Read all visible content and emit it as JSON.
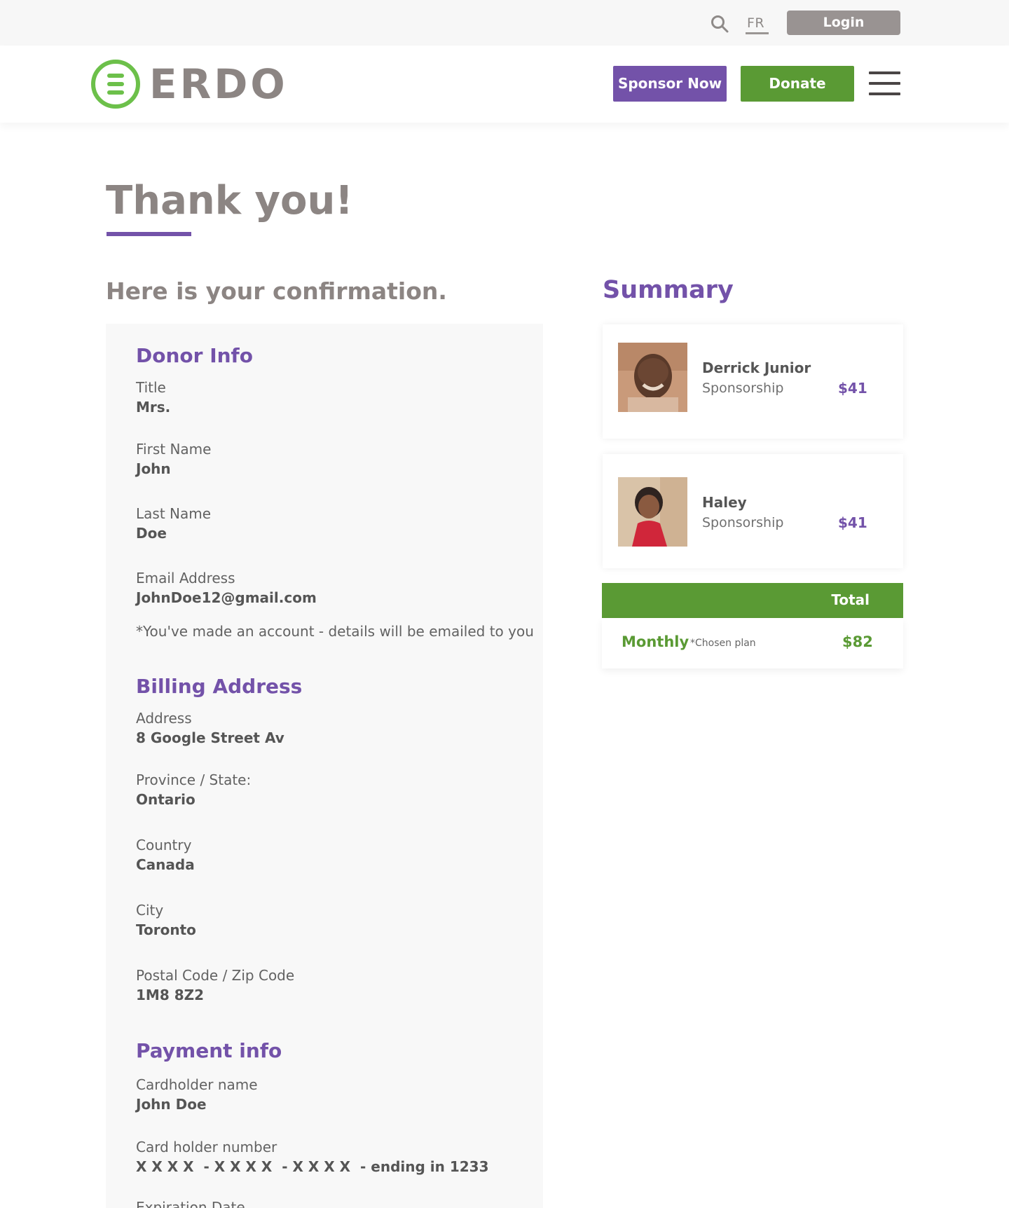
{
  "topbar": {
    "language": "FR",
    "login_label": "Login"
  },
  "header": {
    "logo_text": "ERDO",
    "sponsor_label": "Sponsor Now",
    "donate_label": "Donate"
  },
  "page": {
    "title": "Thank you!",
    "confirmation_heading": "Here is your confirmation."
  },
  "donor_info": {
    "heading": "Donor Info",
    "title_label": "Title",
    "title_value": "Mrs.",
    "first_name_label": "First Name",
    "first_name_value": "John",
    "last_name_label": "Last Name",
    "last_name_value": "Doe",
    "email_label": "Email Address",
    "email_value": "JohnDoe12@gmail.com",
    "account_note": "*You've made an account - details will be emailed to you"
  },
  "billing": {
    "heading": "Billing Address",
    "address_label": "Address",
    "address_value": "8 Google Street Av",
    "province_label": "Province / State:",
    "province_value": "Ontario",
    "country_label": "Country",
    "country_value": "Canada",
    "city_label": "City",
    "city_value": "Toronto",
    "postal_label": "Postal Code / Zip Code",
    "postal_value": "1M8 8Z2"
  },
  "payment": {
    "heading": "Payment info",
    "cardholder_label": "Cardholder name",
    "cardholder_value": "John Doe",
    "card_number_label": "Card holder number",
    "card_number_value": "X X X X  - X X X X  - X X X X  - ending in 1233",
    "expiration_label": "Expiration Date"
  },
  "summary": {
    "heading": "Summary",
    "items": [
      {
        "name": "Derrick Junior",
        "type": "Sponsorship",
        "price": "$41"
      },
      {
        "name": "Haley",
        "type": "Sponsorship",
        "price": "$41"
      }
    ],
    "total_label": "Total",
    "plan": "Monthly",
    "plan_note": "*Chosen plan",
    "total_amount": "$82"
  },
  "colors": {
    "brand_purple": "#7352a9",
    "brand_green": "#5a9a34",
    "logo_green": "#6cc04a",
    "logo_gray": "#8c8583"
  }
}
